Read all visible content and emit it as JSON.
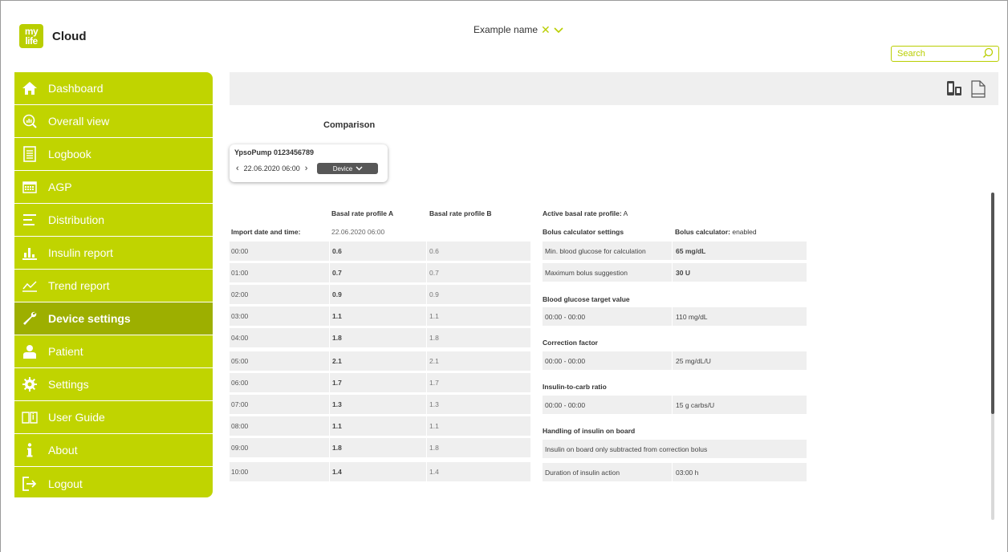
{
  "logo": {
    "badge_line1": "my",
    "badge_line2": "life",
    "text": "Cloud"
  },
  "header": {
    "patient_name": "Example name",
    "close_icon": "close-icon",
    "dropdown_icon": "chevron-down-icon"
  },
  "search": {
    "placeholder": "Search",
    "icon": "search-icon"
  },
  "sidebar": {
    "items": [
      {
        "label": "Dashboard",
        "icon": "home-icon"
      },
      {
        "label": "Overall view",
        "icon": "magnifier-chart-icon"
      },
      {
        "label": "Logbook",
        "icon": "logbook-icon"
      },
      {
        "label": "AGP",
        "icon": "calendar-icon"
      },
      {
        "label": "Distribution",
        "icon": "distribution-icon"
      },
      {
        "label": "Insulin report",
        "icon": "bar-chart-icon"
      },
      {
        "label": "Trend report",
        "icon": "trend-icon"
      },
      {
        "label": "Device settings",
        "icon": "wrench-icon",
        "active": true
      },
      {
        "label": "Patient",
        "icon": "person-icon"
      },
      {
        "label": "Settings",
        "icon": "gear-icon"
      },
      {
        "label": "User Guide",
        "icon": "book-icon"
      },
      {
        "label": "About",
        "icon": "info-icon"
      },
      {
        "label": "Logout",
        "icon": "logout-icon"
      }
    ]
  },
  "toolbar": {
    "devices_icon": "devices-icon",
    "document_icon": "document-icon"
  },
  "main": {
    "comparison_title": "Comparison",
    "device": {
      "name": "YpsoPump 0123456789",
      "date": "22.06.2020 06:00",
      "button_label": "Device"
    }
  },
  "basal": {
    "headers": {
      "profile_a": "Basal rate profile A",
      "profile_b": "Basal rate profile B"
    },
    "import_label": "Import date and time:",
    "import_value": "22.06.2020 06:00",
    "rows": [
      {
        "time": "00:00",
        "a": "0.6",
        "b": "0.6"
      },
      {
        "time": "01:00",
        "a": "0.7",
        "b": "0.7"
      },
      {
        "time": "02:00",
        "a": "0.9",
        "b": "0.9"
      },
      {
        "time": "03:00",
        "a": "1.1",
        "b": "1.1"
      },
      {
        "time": "04:00",
        "a": "1.8",
        "b": "1.8"
      },
      {
        "time": "05:00",
        "a": "2.1",
        "b": "2.1"
      },
      {
        "time": "06:00",
        "a": "1.7",
        "b": "1.7"
      },
      {
        "time": "07:00",
        "a": "1.3",
        "b": "1.3"
      },
      {
        "time": "08:00",
        "a": "1.1",
        "b": "1.1"
      },
      {
        "time": "09:00",
        "a": "1.8",
        "b": "1.8"
      },
      {
        "time": "10:00",
        "a": "1.4",
        "b": "1.4"
      }
    ]
  },
  "right": {
    "active_profile_label": "Active basal rate profile:",
    "active_profile_value": "A",
    "bolus_settings_title": "Bolus calculator settings",
    "bolus_calculator_label": "Bolus calculator:",
    "bolus_calculator_value": "enabled",
    "min_bg_label": "Min. blood glucose for calculation",
    "min_bg_value": "65 mg/dL",
    "max_bolus_label": "Maximum bolus suggestion",
    "max_bolus_value": "30 U",
    "bg_target_title": "Blood glucose target value",
    "bg_target_range": "00:00 - 00:00",
    "bg_target_value": "110 mg/dL",
    "correction_title": "Correction factor",
    "correction_range": "00:00 - 00:00",
    "correction_value": "25 mg/dL/U",
    "icr_title": "Insulin-to-carb ratio",
    "icr_range": "00:00 - 00:00",
    "icr_value": "15 g carbs/U",
    "iob_title": "Handling of insulin on board",
    "iob_text": "Insulin on board only subtracted from correction bolus",
    "duration_label": "Duration of insulin action",
    "duration_value": "03:00 h"
  },
  "colors": {
    "accent": "#c0d400",
    "active": "#9daf00",
    "row_bg": "#efefef"
  }
}
